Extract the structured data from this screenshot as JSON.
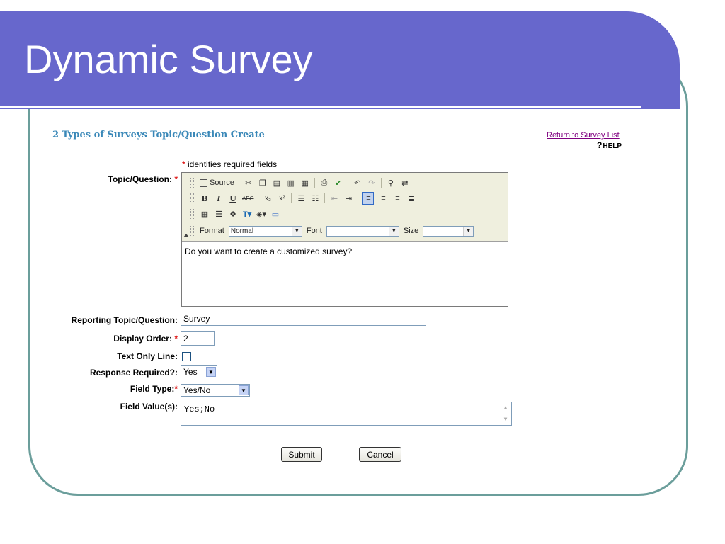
{
  "slide": {
    "title": "Dynamic Survey"
  },
  "form": {
    "heading": "2 Types of Surveys Topic/Question Create",
    "return_link": "Return to Survey List",
    "help_link": "HELP",
    "required_note": "identifies required fields",
    "required_marker": "*"
  },
  "labels": {
    "topic_question": "Topic/Question:",
    "reporting_topic": "Reporting Topic/Question:",
    "display_order": "Display Order:",
    "text_only_line": "Text Only Line:",
    "response_required": "Response Required?:",
    "field_type": "Field Type:",
    "field_values": "Field Value(s):"
  },
  "editor": {
    "source_label": "Source",
    "format_label": "Format",
    "format_value": "Normal",
    "font_label": "Font",
    "font_value": "",
    "size_label": "Size",
    "size_value": "",
    "content": "Do you want to create a customized survey?"
  },
  "fields": {
    "reporting_topic_value": "Survey",
    "display_order_value": "2",
    "text_only_line_checked": false,
    "response_required_value": "Yes",
    "field_type_value": "Yes/No",
    "field_values_value": "Yes;No"
  },
  "buttons": {
    "submit": "Submit",
    "cancel": "Cancel"
  },
  "colors": {
    "title_band": "#6767cc",
    "frame_border": "#6b9e9b",
    "heading": "#3a88b8",
    "required_star": "#e02020",
    "visited_link": "#800080"
  }
}
